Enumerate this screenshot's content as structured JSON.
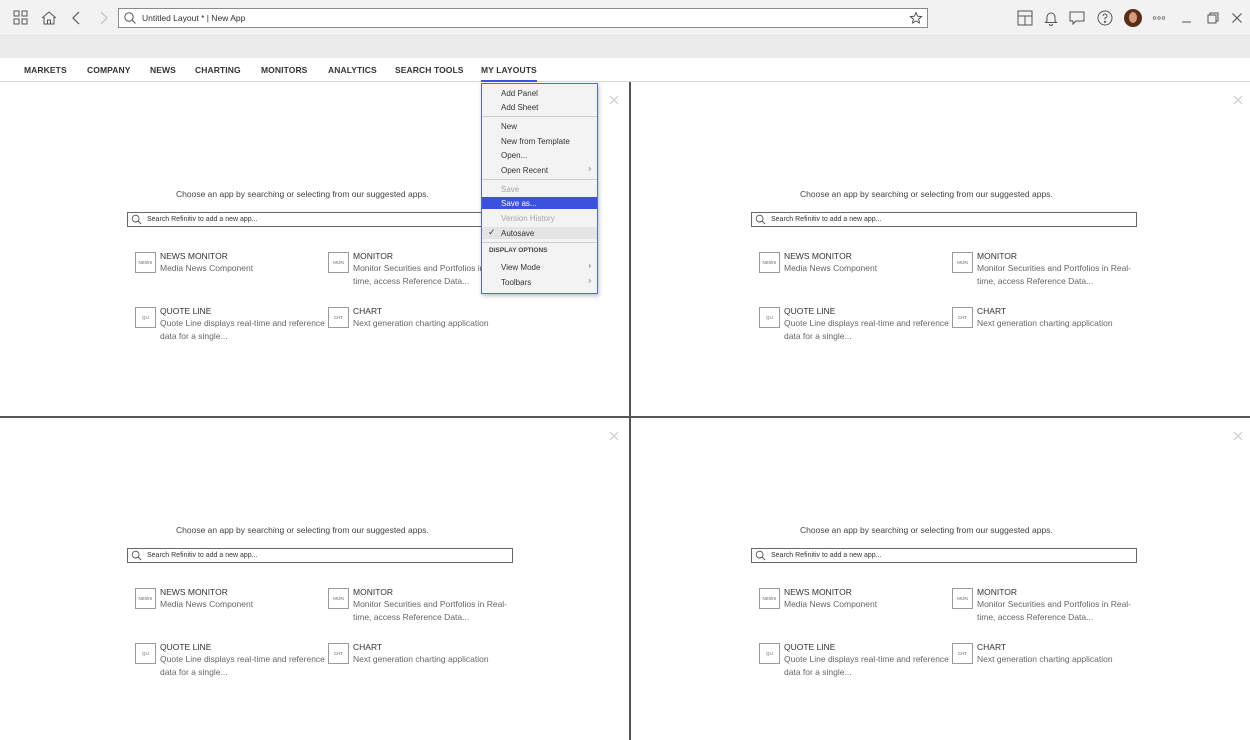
{
  "titlebar": {
    "address": "Untitled Layout * | New App"
  },
  "nav": {
    "items": [
      "MARKETS",
      "COMPANY",
      "NEWS",
      "CHARTING",
      "MONITORS",
      "ANALYTICS",
      "SEARCH TOOLS",
      "MY LAYOUTS"
    ]
  },
  "panel": {
    "prompt": "Choose an app by searching or selecting from our suggested apps.",
    "search_placeholder": "Search Refinitiv to add a new app...",
    "apps": [
      {
        "badge": "NEWS",
        "name": "NEWS MONITOR",
        "desc": "Media News Component"
      },
      {
        "badge": "MON",
        "name": "MONITOR",
        "desc": "Monitor Securities and Portfolios in Real-time, access Reference Data..."
      },
      {
        "badge": "QU",
        "name": "QUOTE LINE",
        "desc": "Quote Line displays real-time and reference data for a single..."
      },
      {
        "badge": "CHT",
        "name": "CHART",
        "desc": "Next generation charting application"
      }
    ]
  },
  "menu": {
    "add_panel": "Add Panel",
    "add_sheet": "Add Sheet",
    "new": "New",
    "new_from_template": "New from Template",
    "open": "Open...",
    "open_recent": "Open Recent",
    "save": "Save",
    "save_as": "Save as...",
    "version_history": "Version History",
    "autosave": "Autosave",
    "display_options": "DISPLAY OPTIONS",
    "view_mode": "View Mode",
    "toolbars": "Toolbars"
  },
  "icons": {
    "apps": "grid-icon",
    "home": "home-icon",
    "back": "back-arrow-icon",
    "forward": "forward-arrow-icon",
    "search": "search-icon",
    "favorite": "star-icon",
    "layout": "layout-icon",
    "notifications": "bell-icon",
    "chat": "chat-icon",
    "help": "help-icon",
    "more": "more-icon",
    "minimize": "minimize-icon",
    "restore": "restore-icon",
    "close": "close-icon"
  },
  "colors": {
    "accent": "#3b51e0",
    "menu_border": "#4d6bd6"
  }
}
